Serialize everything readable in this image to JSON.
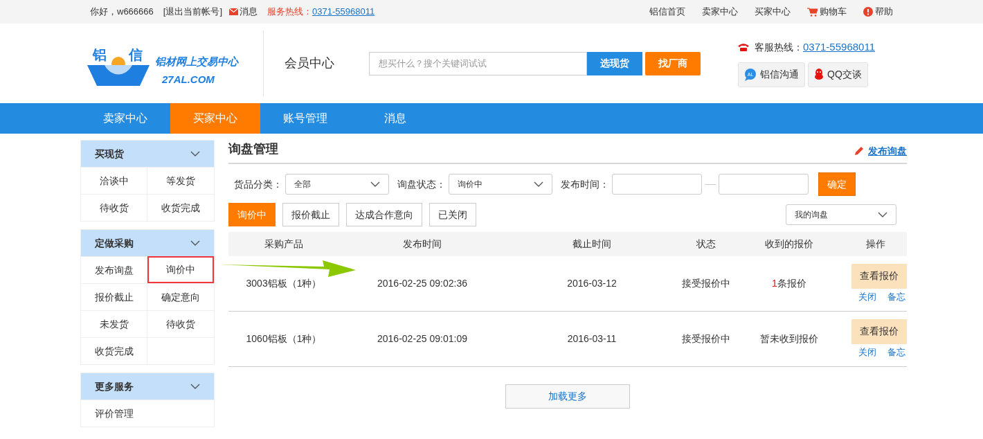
{
  "top_bar": {
    "greeting": "你好，w666666",
    "logout": "[退出当前帐号]",
    "messages": "消息",
    "hotline_label": "服务热线：",
    "hotline_number": "0371-55968011",
    "links": [
      {
        "kind": "plain",
        "label": "铝信首页"
      },
      {
        "kind": "plain",
        "label": "卖家中心"
      },
      {
        "kind": "plain",
        "label": "买家中心"
      },
      {
        "kind": "cart",
        "label": "购物车"
      },
      {
        "kind": "help",
        "label": "帮助"
      }
    ]
  },
  "header": {
    "logo": {
      "char_left": "铝",
      "char_right": "信",
      "slogan": "铝材网上交易中心",
      "domain": "27AL.COM"
    },
    "section_title": "会员中心",
    "search": {
      "placeholder": "想买什么？搜个关键词试试",
      "buttons": [
        {
          "kind": "primary",
          "label": "选现货"
        },
        {
          "kind": "accent",
          "label": "找厂商"
        }
      ]
    },
    "service_label": "客服热线：",
    "service_number": "0371-55968011",
    "chat_buttons": [
      {
        "kind": "al",
        "icon_text": "AL",
        "label": "铝信沟通"
      },
      {
        "kind": "qq",
        "label": "QQ交谈"
      }
    ]
  },
  "nav": [
    {
      "label": "卖家中心",
      "selected": false
    },
    {
      "label": "买家中心",
      "selected": true
    },
    {
      "label": "账号管理",
      "selected": false
    },
    {
      "label": "消息",
      "selected": false
    }
  ],
  "sidebar": [
    {
      "title": "买现货",
      "expanded": true,
      "items": [
        {
          "label": "洽谈中",
          "selected": false
        },
        {
          "label": "等发货",
          "selected": false
        },
        {
          "label": "待收货",
          "selected": false
        },
        {
          "label": "收货完成",
          "selected": false
        }
      ]
    },
    {
      "title": "定做采购",
      "expanded": true,
      "items": [
        {
          "label": "发布询盘",
          "selected": false
        },
        {
          "label": "询价中",
          "selected": true
        },
        {
          "label": "报价截止",
          "selected": false
        },
        {
          "label": "确定意向",
          "selected": false
        },
        {
          "label": "未发货",
          "selected": false
        },
        {
          "label": "待收货",
          "selected": false
        },
        {
          "label": "收货完成",
          "selected": false
        }
      ]
    },
    {
      "title": "更多服务",
      "expanded": true,
      "items": [
        {
          "label": "评价管理",
          "selected": false
        }
      ]
    }
  ],
  "main": {
    "title": "询盘管理",
    "publish_link": "发布询盘",
    "filters": {
      "category_label": "货品分类：",
      "category_value": "全部",
      "status_label": "询盘状态：",
      "status_value": "询价中",
      "time_label": "发布时间：",
      "confirm": "确定"
    },
    "status_tabs": [
      {
        "label": "询价中",
        "selected": true
      },
      {
        "label": "报价截止",
        "selected": false
      },
      {
        "label": "达成合作意向",
        "selected": false
      },
      {
        "label": "已关闭",
        "selected": false
      }
    ],
    "scope_select": "我的询盘",
    "table": {
      "columns": [
        "采购产品",
        "发布时间",
        "截止时间",
        "状态",
        "收到的报价",
        "操作"
      ],
      "rows": [
        {
          "product": "3003铝板（1种）",
          "published": "2016-02-25 09:02:36",
          "deadline": "2016-03-12",
          "status": "接受报价中",
          "quote_count": "1",
          "quote_text": "条报价",
          "view": "查看报价",
          "close": "关闭",
          "note": "备忘"
        },
        {
          "product": "1060铝板（1种）",
          "published": "2016-02-25 09:01:09",
          "deadline": "2016-03-11",
          "status": "接受报价中",
          "quote_text": "暂未收到报价",
          "view": "查看报价",
          "close": "关闭",
          "note": "备忘"
        }
      ]
    },
    "load_more": "加载更多"
  }
}
